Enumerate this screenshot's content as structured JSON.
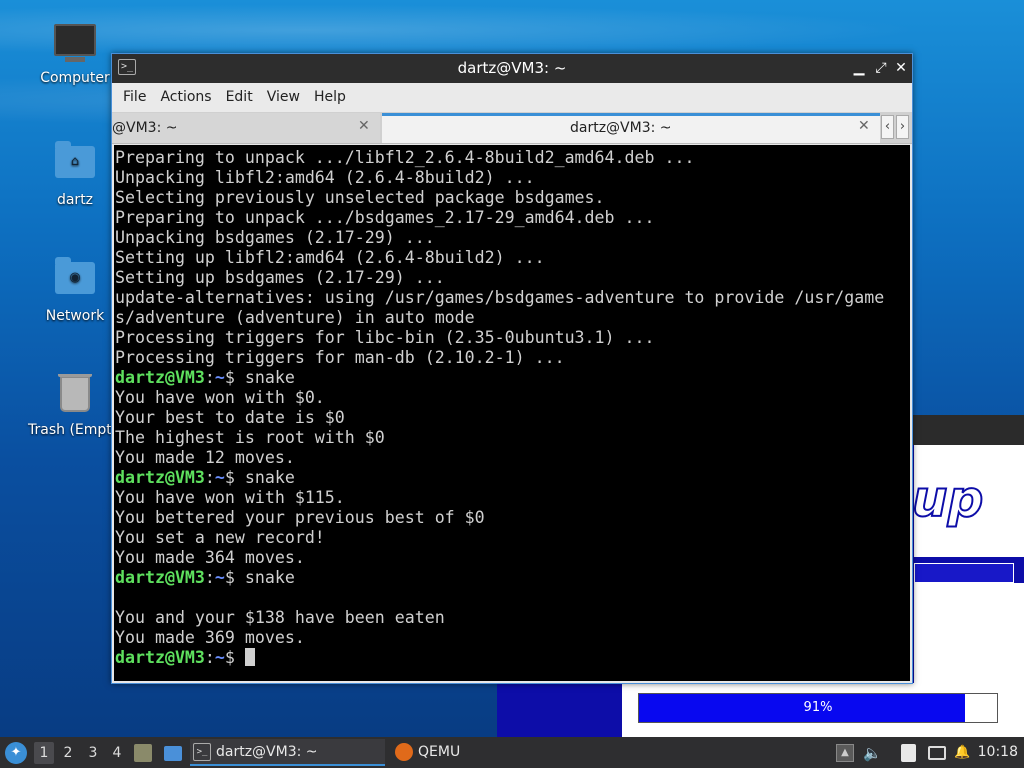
{
  "desktop": {
    "icons": [
      {
        "label": "Computer"
      },
      {
        "label": "dartz"
      },
      {
        "label": "Network"
      },
      {
        "label": "Trash (Empty)"
      }
    ]
  },
  "qemu_window": {
    "banner_text": "up",
    "progress": {
      "percent": 91,
      "label": "91%"
    }
  },
  "terminal_window": {
    "title": "dartz@VM3: ~",
    "menu": [
      "File",
      "Actions",
      "Edit",
      "View",
      "Help"
    ],
    "tabs": [
      {
        "label": "@VM3: ~",
        "active": false
      },
      {
        "label": "dartz@VM3: ~",
        "active": true
      }
    ],
    "prompt_user": "dartz@VM3",
    "prompt_path": "~",
    "lines": [
      {
        "text": "Preparing to unpack .../libfl2_2.6.4-8build2_amd64.deb ..."
      },
      {
        "text": "Unpacking libfl2:amd64 (2.6.4-8build2) ..."
      },
      {
        "text": "Selecting previously unselected package bsdgames."
      },
      {
        "text": "Preparing to unpack .../bsdgames_2.17-29_amd64.deb ..."
      },
      {
        "text": "Unpacking bsdgames (2.17-29) ..."
      },
      {
        "text": "Setting up libfl2:amd64 (2.6.4-8build2) ..."
      },
      {
        "text": "Setting up bsdgames (2.17-29) ..."
      },
      {
        "text": "update-alternatives: using /usr/games/bsdgames-adventure to provide /usr/game"
      },
      {
        "text": "s/adventure (adventure) in auto mode"
      },
      {
        "text": "Processing triggers for libc-bin (2.35-0ubuntu3.1) ..."
      },
      {
        "text": "Processing triggers for man-db (2.10.2-1) ..."
      },
      {
        "prompt": true,
        "text": "snake"
      },
      {
        "text": "You have won with $0."
      },
      {
        "text": "Your best to date is $0"
      },
      {
        "text": "The highest is root with $0"
      },
      {
        "text": "You made 12 moves."
      },
      {
        "prompt": true,
        "text": "snake"
      },
      {
        "text": "You have won with $115."
      },
      {
        "text": "You bettered your previous best of $0"
      },
      {
        "text": "You set a new record!"
      },
      {
        "text": "You made 364 moves."
      },
      {
        "prompt": true,
        "text": "snake"
      },
      {
        "text": ""
      },
      {
        "text": "You and your $138 have been eaten"
      },
      {
        "text": "You made 369 moves."
      },
      {
        "prompt": true,
        "text": "",
        "cursor": true
      }
    ]
  },
  "taskbar": {
    "workspaces": [
      "1",
      "2",
      "3",
      "4"
    ],
    "active_workspace": "1",
    "tasks": [
      {
        "label": "dartz@VM3: ~",
        "icon": "terminal-icon",
        "active": true
      },
      {
        "label": "QEMU",
        "icon": "qemu-icon",
        "active": false
      }
    ],
    "clock": "10:18"
  }
}
